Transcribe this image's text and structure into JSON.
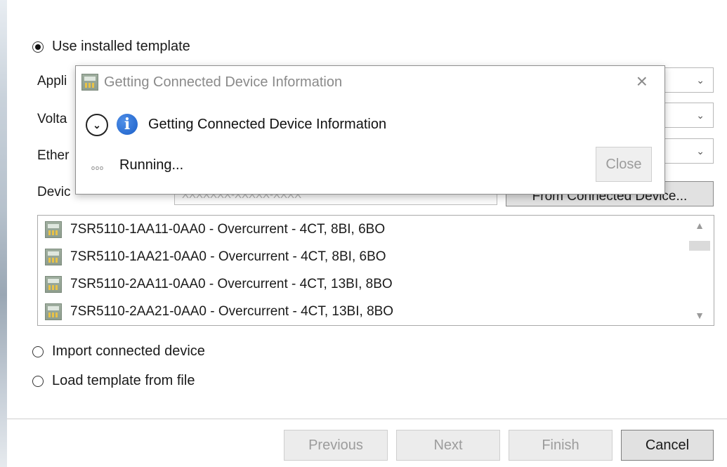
{
  "template_options": {
    "use_installed_template": "Use installed template",
    "import_connected_device": "Import connected device",
    "load_template_from_file": "Load template from file"
  },
  "fields": {
    "application_label": "Appli",
    "voltage_label": "Volta",
    "ethernet_label": "Ether",
    "device_label": "Devic",
    "device_placeholder": "XXXXXXX-XXXXX-XXXX",
    "from_connected_device": "From Connected Device..."
  },
  "device_list": [
    "7SR5110-1AA11-0AA0 - Overcurrent - 4CT, 8BI, 6BO",
    "7SR5110-1AA21-0AA0 - Overcurrent - 4CT, 8BI, 6BO",
    "7SR5110-2AA11-0AA0 - Overcurrent - 4CT, 13BI, 8BO",
    "7SR5110-2AA21-0AA0 - Overcurrent - 4CT, 13BI, 8BO"
  ],
  "buttons": {
    "previous": "Previous",
    "next": "Next",
    "finish": "Finish",
    "cancel": "Cancel"
  },
  "popup": {
    "title": "Getting Connected Device Information",
    "heading": "Getting Connected Device Information",
    "status": "Running...",
    "close": "Close",
    "close_icon": "×"
  },
  "icons": {
    "chevron": "⌄",
    "expand": "⌄",
    "info": "i"
  },
  "colors": {
    "disabled_text": "#9c9c9c",
    "info_blue": "#1b5fc8"
  }
}
